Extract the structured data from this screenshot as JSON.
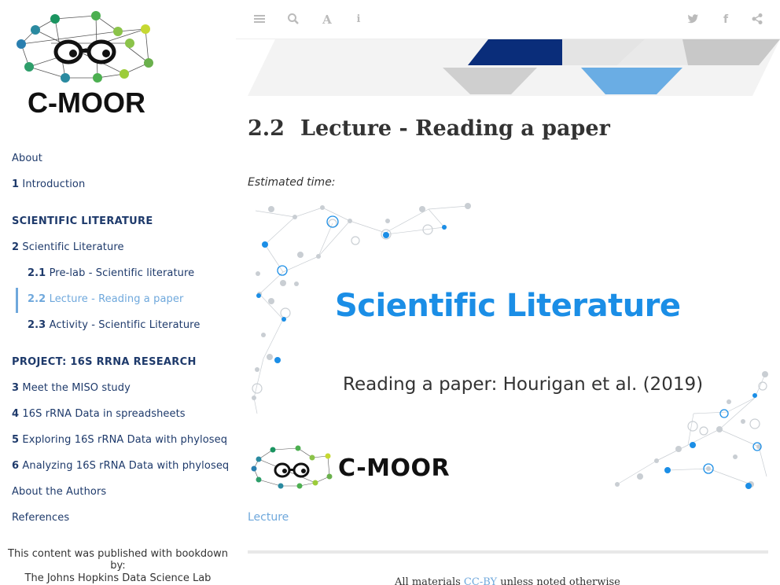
{
  "sidebar": {
    "logo_text": "C-MOOR",
    "items": [
      {
        "num": "",
        "label": "About"
      },
      {
        "num": "1",
        "label": "Introduction"
      },
      {
        "num": "",
        "label": "SCIENTIFIC LITERATURE"
      },
      {
        "num": "2",
        "label": "Scientific Literature"
      },
      {
        "num": "2.1",
        "label": "Pre-lab - Scientific literature"
      },
      {
        "num": "2.2",
        "label": "Lecture - Reading a paper"
      },
      {
        "num": "2.3",
        "label": "Activity - Scientific Literature"
      },
      {
        "num": "",
        "label": "PROJECT: 16S RRNA RESEARCH"
      },
      {
        "num": "3",
        "label": "Meet the MISO study"
      },
      {
        "num": "4",
        "label": "16S rRNA Data in spreadsheets"
      },
      {
        "num": "5",
        "label": "Exploring 16S rRNA Data with phyloseq"
      },
      {
        "num": "6",
        "label": "Analyzing 16S rRNA Data with phyloseq"
      },
      {
        "num": "",
        "label": "About the Authors"
      },
      {
        "num": "",
        "label": "References"
      }
    ],
    "published_with": "This content was published with bookdown by:",
    "publisher": "The Johns Hopkins Data Science Lab"
  },
  "toolbar": {
    "icons": [
      "menu-icon",
      "search-icon",
      "font-icon",
      "info-icon",
      "twitter-icon",
      "facebook-icon",
      "share-icon"
    ]
  },
  "main": {
    "chapter_num": "2.2",
    "chapter_title": "Lecture - Reading a paper",
    "estimated_time": "Estimated time:",
    "slide": {
      "title": "Scientific Literature",
      "subtitle": "Reading a paper: Hourigan et al. (2019)",
      "logo_text": "C-MOOR"
    },
    "caption_link": "Lecture",
    "footer_prefix": "All materials ",
    "footer_link": "CC-BY",
    "footer_suffix": " unless noted otherwise"
  },
  "colors": {
    "accent": "#6fa8dc",
    "nav_text": "#1e3a6b",
    "slide_title": "#1b8ee6"
  }
}
